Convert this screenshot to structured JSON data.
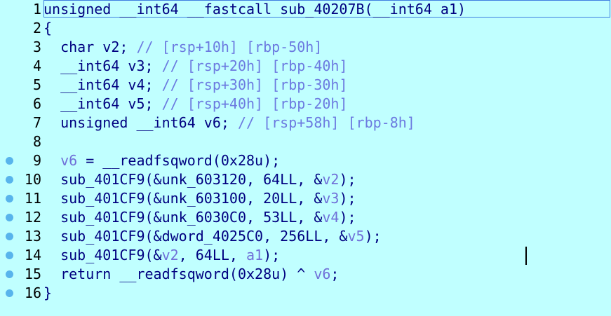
{
  "editor": {
    "lines": [
      {
        "num": "1",
        "bp": false,
        "parts": [
          {
            "t": "unsigned __int64 __fastcall sub_40207B(__int64 a1)",
            "c": "norm"
          }
        ]
      },
      {
        "num": "2",
        "bp": false,
        "parts": [
          {
            "t": "{",
            "c": "norm"
          }
        ]
      },
      {
        "num": "3",
        "bp": false,
        "parts": [
          {
            "t": "  char v2; ",
            "c": "norm"
          },
          {
            "t": "// [rsp+10h] [rbp-50h]",
            "c": "cmt"
          }
        ]
      },
      {
        "num": "4",
        "bp": false,
        "parts": [
          {
            "t": "  __int64 v3; ",
            "c": "norm"
          },
          {
            "t": "// [rsp+20h] [rbp-40h]",
            "c": "cmt"
          }
        ]
      },
      {
        "num": "5",
        "bp": false,
        "parts": [
          {
            "t": "  __int64 v4; ",
            "c": "norm"
          },
          {
            "t": "// [rsp+30h] [rbp-30h]",
            "c": "cmt"
          }
        ]
      },
      {
        "num": "6",
        "bp": false,
        "parts": [
          {
            "t": "  __int64 v5; ",
            "c": "norm"
          },
          {
            "t": "// [rsp+40h] [rbp-20h]",
            "c": "cmt"
          }
        ]
      },
      {
        "num": "7",
        "bp": false,
        "parts": [
          {
            "t": "  unsigned __int64 v6; ",
            "c": "norm"
          },
          {
            "t": "// [rsp+58h] [rbp-8h]",
            "c": "cmt"
          }
        ]
      },
      {
        "num": "8",
        "bp": false,
        "parts": []
      },
      {
        "num": "9",
        "bp": true,
        "parts": [
          {
            "t": "  ",
            "c": "norm"
          },
          {
            "t": "v6",
            "c": "var"
          },
          {
            "t": " = __readfsqword(0x28u);",
            "c": "norm"
          }
        ]
      },
      {
        "num": "10",
        "bp": true,
        "parts": [
          {
            "t": "  sub_401CF9(&unk_603120, 64LL, &",
            "c": "norm"
          },
          {
            "t": "v2",
            "c": "var"
          },
          {
            "t": ");",
            "c": "norm"
          }
        ]
      },
      {
        "num": "11",
        "bp": true,
        "parts": [
          {
            "t": "  sub_401CF9(&unk_603100, 20LL, &",
            "c": "norm"
          },
          {
            "t": "v3",
            "c": "var"
          },
          {
            "t": ");",
            "c": "norm"
          }
        ]
      },
      {
        "num": "12",
        "bp": true,
        "parts": [
          {
            "t": "  sub_401CF9(&unk_6030C0, 53LL, &",
            "c": "norm"
          },
          {
            "t": "v4",
            "c": "var"
          },
          {
            "t": ");",
            "c": "norm"
          }
        ]
      },
      {
        "num": "13",
        "bp": true,
        "parts": [
          {
            "t": "  sub_401CF9(&dword_4025C0, 256LL, &",
            "c": "norm"
          },
          {
            "t": "v5",
            "c": "var"
          },
          {
            "t": ");",
            "c": "norm"
          }
        ]
      },
      {
        "num": "14",
        "bp": true,
        "parts": [
          {
            "t": "  sub_401CF9(&",
            "c": "norm"
          },
          {
            "t": "v2",
            "c": "var"
          },
          {
            "t": ", 64LL, ",
            "c": "norm"
          },
          {
            "t": "a1",
            "c": "var"
          },
          {
            "t": ");",
            "c": "norm"
          }
        ]
      },
      {
        "num": "15",
        "bp": true,
        "parts": [
          {
            "t": "  return __readfsqword(0x28u) ^ ",
            "c": "norm"
          },
          {
            "t": "v6",
            "c": "var"
          },
          {
            "t": ";",
            "c": "norm"
          }
        ]
      },
      {
        "num": "16",
        "bp": true,
        "parts": [
          {
            "t": "}",
            "c": "norm"
          }
        ]
      }
    ]
  }
}
